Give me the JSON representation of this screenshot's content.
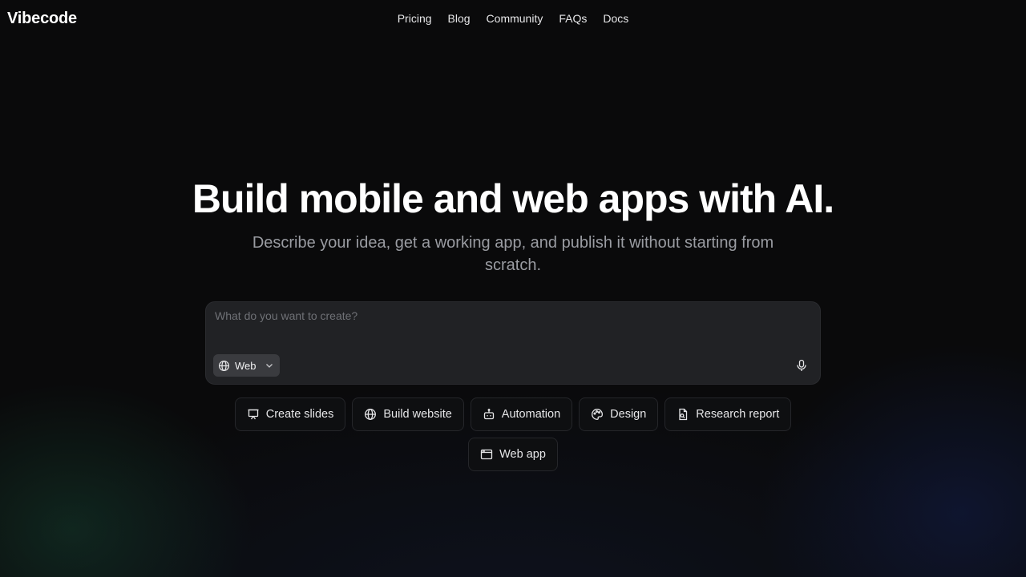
{
  "brand": {
    "name": "Vibecode"
  },
  "nav": {
    "items": [
      {
        "label": "Pricing"
      },
      {
        "label": "Blog"
      },
      {
        "label": "Community"
      },
      {
        "label": "FAQs"
      },
      {
        "label": "Docs"
      }
    ]
  },
  "hero": {
    "title": "Build mobile and web apps with AI.",
    "subtitle": "Describe your idea, get a working app, and publish it without starting from scratch."
  },
  "prompt": {
    "placeholder": "What do you want to create?",
    "value": "",
    "mode": {
      "label": "Web",
      "icon": "globe-icon"
    },
    "mic_icon": "microphone-icon"
  },
  "suggestions": [
    {
      "label": "Create slides",
      "icon": "presentation-icon"
    },
    {
      "label": "Build website",
      "icon": "globe-icon"
    },
    {
      "label": "Automation",
      "icon": "robot-icon"
    },
    {
      "label": "Design",
      "icon": "palette-icon"
    },
    {
      "label": "Research report",
      "icon": "document-icon"
    },
    {
      "label": "Web app",
      "icon": "browser-window-icon"
    }
  ],
  "colors": {
    "background": "#0a0a0b",
    "prompt_bg": "#212225",
    "chip_bg": "#0e0f11",
    "text": "#f2f2f3",
    "muted": "#9a9ca2"
  }
}
